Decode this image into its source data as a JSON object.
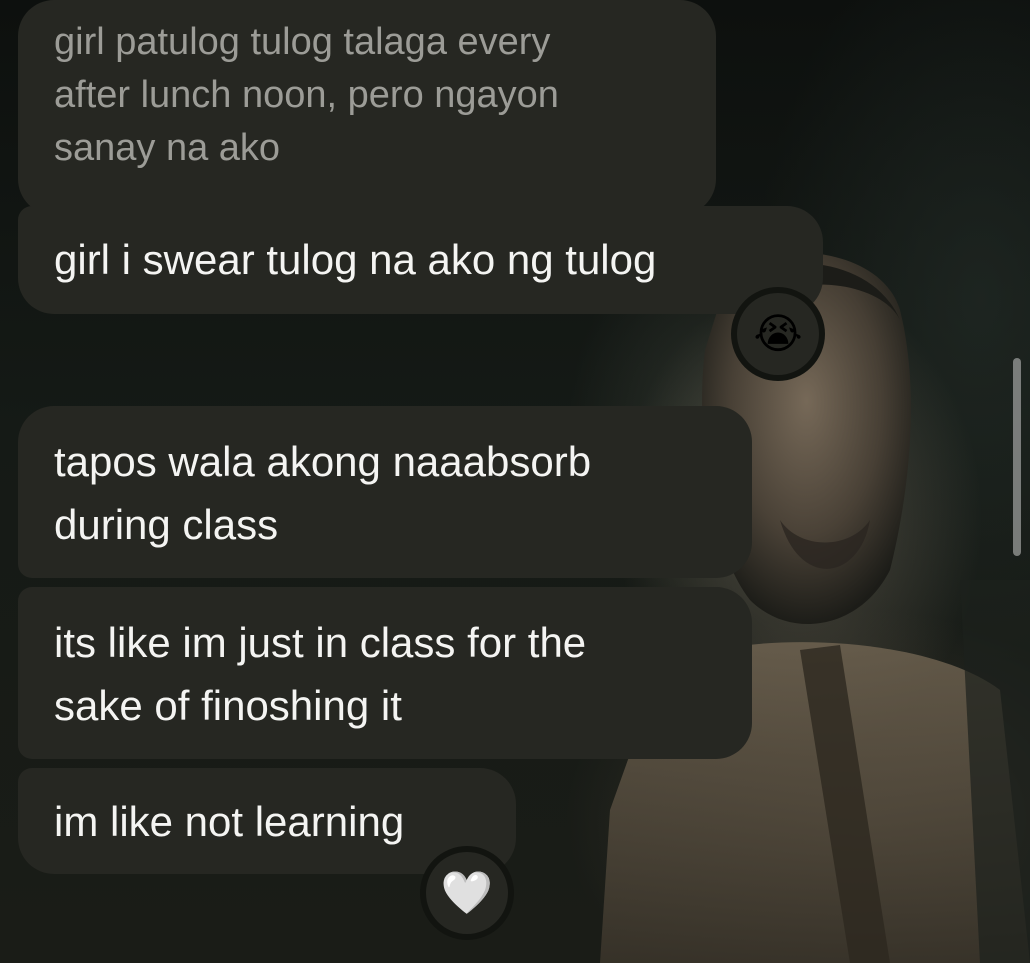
{
  "messages": [
    {
      "lines": [
        "girl patulog tulog talaga every",
        "after lunch noon, pero ngayon",
        "sanay na ako"
      ]
    },
    {
      "lines": [
        "girl i swear tulog na ako ng tulog"
      ],
      "reaction": "😭"
    },
    {
      "lines": [
        "tapos wala akong naaabsorb",
        "during class"
      ]
    },
    {
      "lines": [
        "its like im just in class for the",
        "sake of finoshing it"
      ]
    },
    {
      "lines": [
        "im like not learning"
      ],
      "reaction": "🤍"
    }
  ],
  "reaction_icons": {
    "crying": "loudly-crying-face-icon",
    "heart": "white-heart-icon"
  },
  "colors": {
    "bubble": "#262722",
    "text": "#f4f4f2",
    "faded_text": "#9c9c97"
  }
}
